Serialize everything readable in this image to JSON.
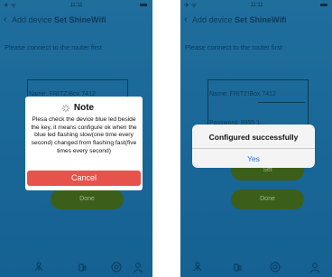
{
  "status_bar": {
    "time": "11:11"
  },
  "nav": {
    "back_label": "Add device",
    "title": "Set ShineWifi"
  },
  "hint": "Please connect to the router first",
  "form": {
    "name_label": "Name: FRITZ!Box 7412",
    "password_label": "Password: 9955 1..."
  },
  "buttons": {
    "set": "Set",
    "done": "Done"
  },
  "tabs": [
    {
      "icon": "network-icon"
    },
    {
      "icon": "device-icon"
    },
    {
      "icon": "target-icon"
    },
    {
      "icon": "user-icon"
    }
  ],
  "note_dialog": {
    "title": "Note",
    "body": "Plesa check the device blue led beside the key, it means configure ok when the blue led flashing slow(one time every second) changed from flashing fast(five times every second)",
    "cancel": "Cancel"
  },
  "success_dialog": {
    "message": "Configured successfully",
    "confirm": "Yes"
  },
  "colors": {
    "background": "#1b82c4",
    "button_green": "#4f7f23",
    "cancel_red": "#e8524c",
    "link_blue": "#2a72d6"
  }
}
